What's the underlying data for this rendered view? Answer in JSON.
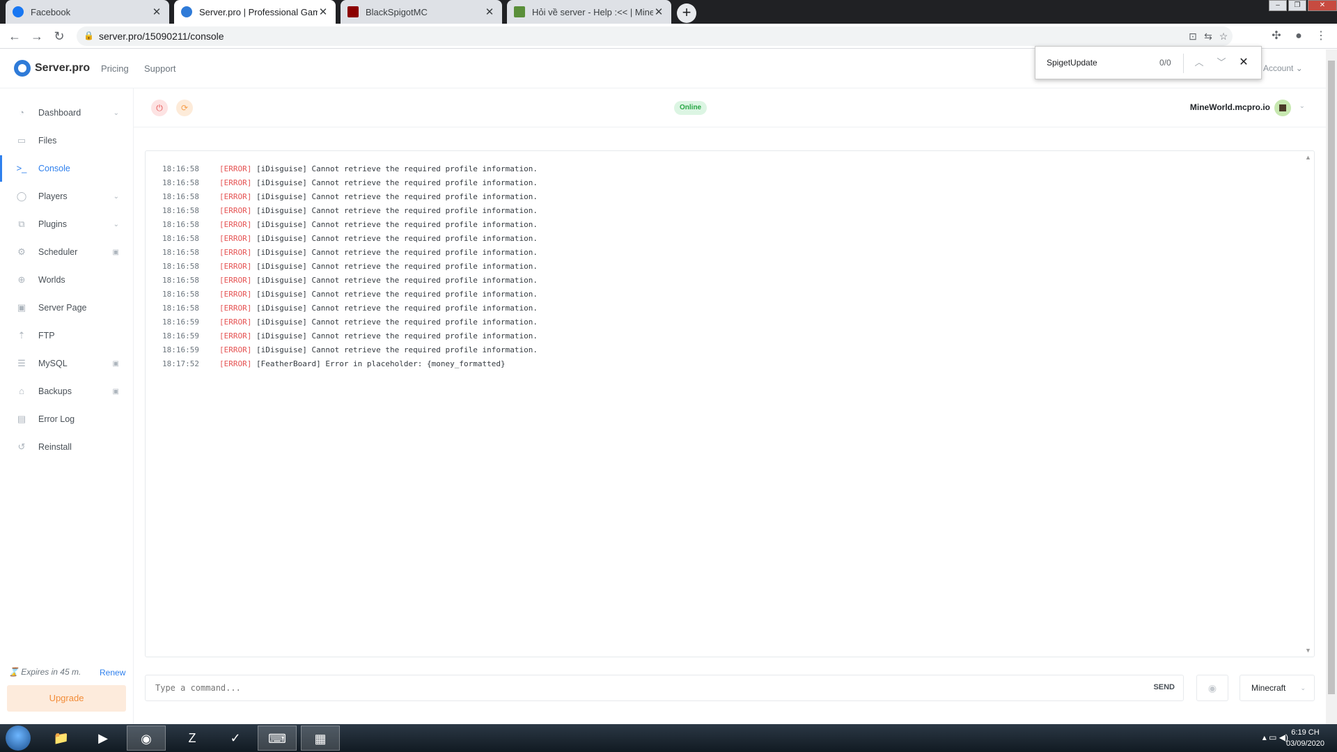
{
  "browser": {
    "tabs": [
      {
        "title": "Facebook",
        "favicon_color": "#1877f2"
      },
      {
        "title": "Server.pro | Professional Game S",
        "favicon_color": "#2f7bd8"
      },
      {
        "title": "BlackSpigotMC",
        "favicon_color": "#8b0000"
      },
      {
        "title": "Hỏi về server - Help :<< | Minecr",
        "favicon_color": "#5a8f3a"
      }
    ],
    "url": "server.pro/15090211/console"
  },
  "findbar": {
    "query": "SpigetUpdate",
    "count": "0/0"
  },
  "header": {
    "logo": "Server.pro",
    "nav": [
      "Pricing",
      "Support"
    ],
    "account": "Account"
  },
  "sidebar": {
    "items": [
      {
        "label": "Dashboard",
        "icon": "dashboard-icon",
        "glyph": "◔",
        "chev": "⌄"
      },
      {
        "label": "Files",
        "icon": "folder-icon",
        "glyph": "▭"
      },
      {
        "label": "Console",
        "icon": "terminal-icon",
        "glyph": ">_"
      },
      {
        "label": "Players",
        "icon": "user-icon",
        "glyph": "◯",
        "chev": "⌄"
      },
      {
        "label": "Plugins",
        "icon": "plugin-icon",
        "glyph": "⧉",
        "chev": "⌄"
      },
      {
        "label": "Scheduler",
        "icon": "scheduler-icon",
        "glyph": "⚙",
        "lock": "🔒"
      },
      {
        "label": "Worlds",
        "icon": "globe-icon",
        "glyph": "⊕"
      },
      {
        "label": "Server Page",
        "icon": "server-page-icon",
        "glyph": "▣"
      },
      {
        "label": "FTP",
        "icon": "upload-icon",
        "glyph": "⇡"
      },
      {
        "label": "MySQL",
        "icon": "database-icon",
        "glyph": "☰",
        "lock": "🔒"
      },
      {
        "label": "Backups",
        "icon": "backup-icon",
        "glyph": "⌂",
        "lock": "🔒"
      },
      {
        "label": "Error Log",
        "icon": "error-log-icon",
        "glyph": "▤"
      },
      {
        "label": "Reinstall",
        "icon": "reinstall-icon",
        "glyph": "↺"
      }
    ],
    "expires": "Expires in 45 m.",
    "renew": "Renew",
    "upgrade": "Upgrade"
  },
  "server": {
    "status": "Online",
    "address": "MineWorld.mcpro.io"
  },
  "console": {
    "lines": [
      {
        "time": "18:16:58",
        "level": "[ERROR]",
        "msg": "[iDisguise] Cannot retrieve the required profile information."
      },
      {
        "time": "18:16:58",
        "level": "[ERROR]",
        "msg": "[iDisguise] Cannot retrieve the required profile information."
      },
      {
        "time": "18:16:58",
        "level": "[ERROR]",
        "msg": "[iDisguise] Cannot retrieve the required profile information."
      },
      {
        "time": "18:16:58",
        "level": "[ERROR]",
        "msg": "[iDisguise] Cannot retrieve the required profile information."
      },
      {
        "time": "18:16:58",
        "level": "[ERROR]",
        "msg": "[iDisguise] Cannot retrieve the required profile information."
      },
      {
        "time": "18:16:58",
        "level": "[ERROR]",
        "msg": "[iDisguise] Cannot retrieve the required profile information."
      },
      {
        "time": "18:16:58",
        "level": "[ERROR]",
        "msg": "[iDisguise] Cannot retrieve the required profile information."
      },
      {
        "time": "18:16:58",
        "level": "[ERROR]",
        "msg": "[iDisguise] Cannot retrieve the required profile information."
      },
      {
        "time": "18:16:58",
        "level": "[ERROR]",
        "msg": "[iDisguise] Cannot retrieve the required profile information."
      },
      {
        "time": "18:16:58",
        "level": "[ERROR]",
        "msg": "[iDisguise] Cannot retrieve the required profile information."
      },
      {
        "time": "18:16:58",
        "level": "[ERROR]",
        "msg": "[iDisguise] Cannot retrieve the required profile information."
      },
      {
        "time": "18:16:59",
        "level": "[ERROR]",
        "msg": "[iDisguise] Cannot retrieve the required profile information."
      },
      {
        "time": "18:16:59",
        "level": "[ERROR]",
        "msg": "[iDisguise] Cannot retrieve the required profile information."
      },
      {
        "time": "18:16:59",
        "level": "[ERROR]",
        "msg": "[iDisguise] Cannot retrieve the required profile information."
      },
      {
        "time": "18:17:52",
        "level": "[ERROR]",
        "msg": "[FeatherBoard] Error in placeholder: {money_formatted}"
      }
    ]
  },
  "command": {
    "placeholder": "Type a command...",
    "send": "SEND",
    "type": "Minecraft"
  },
  "taskbar": {
    "clock_time": "6:19 CH",
    "clock_date": "03/09/2020"
  }
}
